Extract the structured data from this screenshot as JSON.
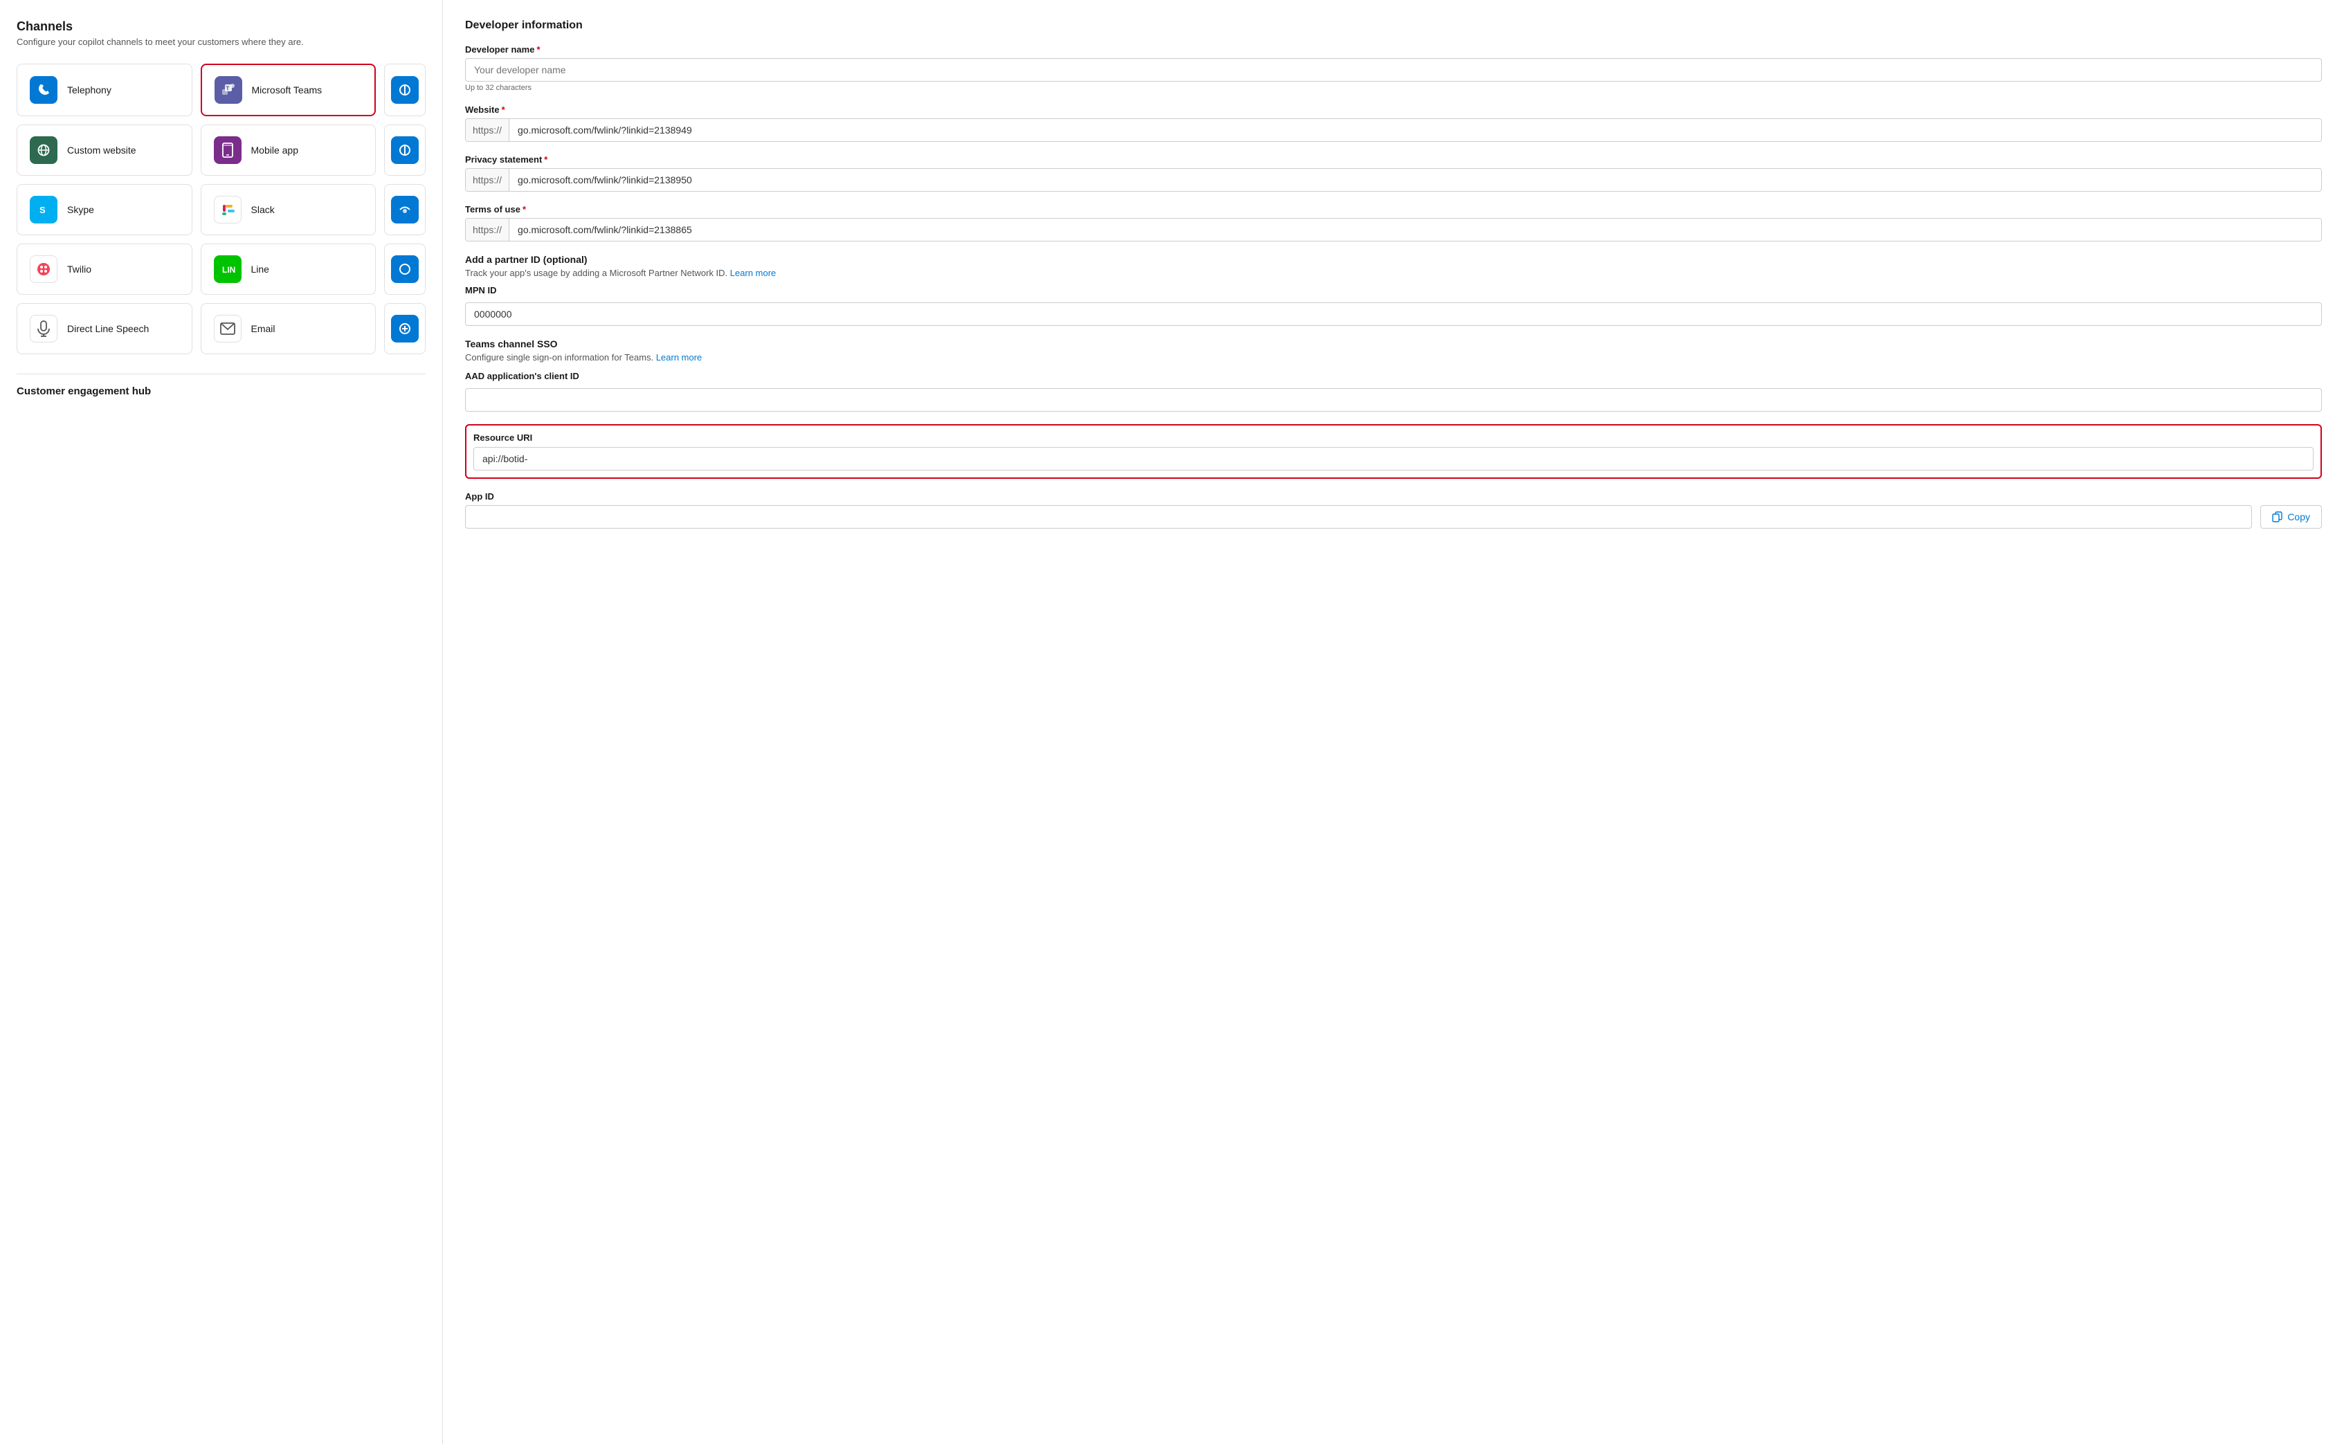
{
  "left": {
    "title": "Channels",
    "subtitle": "Configure your copilot channels to meet your customers where they are.",
    "channels": [
      {
        "id": "telephony",
        "label": "Telephony",
        "icon": "telephony",
        "selected": false,
        "partial": false
      },
      {
        "id": "teams",
        "label": "Microsoft Teams",
        "icon": "teams",
        "selected": true,
        "partial": false
      },
      {
        "id": "website",
        "label": "Custom website",
        "icon": "website",
        "selected": false,
        "partial": false
      },
      {
        "id": "mobile",
        "label": "Mobile app",
        "icon": "mobile",
        "selected": false,
        "partial": false
      },
      {
        "id": "skype",
        "label": "Skype",
        "icon": "skype",
        "selected": false,
        "partial": false
      },
      {
        "id": "slack",
        "label": "Slack",
        "icon": "slack",
        "selected": false,
        "partial": false
      },
      {
        "id": "twilio",
        "label": "Twilio",
        "icon": "twilio",
        "selected": false,
        "partial": false
      },
      {
        "id": "line",
        "label": "Line",
        "icon": "line",
        "selected": false,
        "partial": false
      },
      {
        "id": "speech",
        "label": "Direct Line Speech",
        "icon": "speech",
        "selected": false,
        "partial": false
      },
      {
        "id": "email",
        "label": "Email",
        "icon": "email",
        "selected": false,
        "partial": false
      }
    ],
    "partials": [
      {
        "id": "p1",
        "icon": "partial"
      },
      {
        "id": "p2",
        "icon": "partial"
      },
      {
        "id": "p3",
        "icon": "partial"
      },
      {
        "id": "p4",
        "icon": "partial"
      },
      {
        "id": "p5",
        "icon": "partial"
      }
    ],
    "bottom_section": "Customer engagement hub"
  },
  "right": {
    "section_title": "Developer information",
    "fields": {
      "developer_name_label": "Developer name",
      "developer_name_placeholder": "Your developer name",
      "developer_name_hint": "Up to 32 characters",
      "website_label": "Website",
      "website_prefix": "https://",
      "website_value": "go.microsoft.com/fwlink/?linkid=2138949",
      "privacy_label": "Privacy statement",
      "privacy_prefix": "https://",
      "privacy_value": "go.microsoft.com/fwlink/?linkid=2138950",
      "terms_label": "Terms of use",
      "terms_prefix": "https://",
      "terms_value": "go.microsoft.com/fwlink/?linkid=2138865"
    },
    "partner": {
      "title": "Add a partner ID (optional)",
      "desc": "Track your app's usage by adding a Microsoft Partner Network ID.",
      "learn_more": "Learn more",
      "mpn_label": "MPN ID",
      "mpn_value": "0000000"
    },
    "sso": {
      "title": "Teams channel SSO",
      "desc": "Configure single sign-on information for Teams.",
      "learn_more": "Learn more",
      "aad_label": "AAD application's client ID",
      "aad_value": "",
      "resource_uri_label": "Resource URI",
      "resource_uri_value": "api://botid-",
      "app_id_label": "App ID",
      "app_id_value": ""
    },
    "copy_label": "Copy"
  }
}
